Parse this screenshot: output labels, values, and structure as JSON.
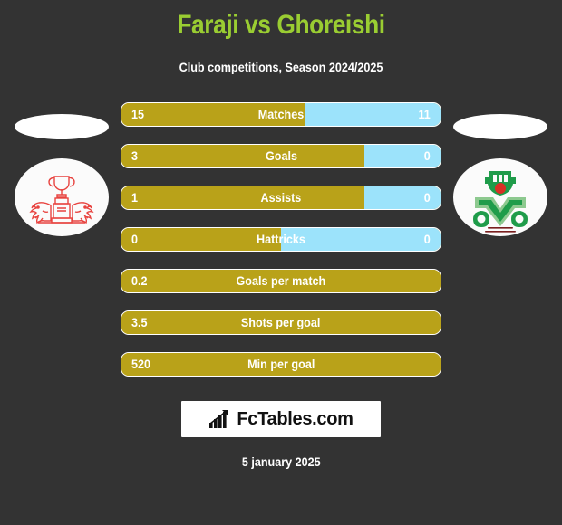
{
  "header": {
    "title": "Faraji vs Ghoreishi",
    "subtitle": "Club competitions, Season 2024/2025",
    "title_color": "#9acd32"
  },
  "colors": {
    "background": "#333333",
    "home_bar": "#b9a219",
    "away_bar": "#9ce3fb",
    "text": "#ffffff",
    "left_crest": "#e8433f",
    "right_crest": "#1f9c4a"
  },
  "players": {
    "home": {
      "name": "Faraji",
      "crest_icon": "trophy-lions-crest-icon",
      "photo_icon": "player-photo-ellipse"
    },
    "away": {
      "name": "Ghoreishi",
      "crest_icon": "green-shield-crest-icon",
      "photo_icon": "player-photo-ellipse"
    }
  },
  "chart_data": {
    "type": "bar",
    "title": "Faraji vs Ghoreishi",
    "subtitle": "Club competitions, Season 2024/2025",
    "orientation": "horizontal-diverging",
    "series": [
      {
        "name": "Faraji",
        "color": "#b9a219"
      },
      {
        "name": "Ghoreishi",
        "color": "#9ce3fb"
      }
    ],
    "categories": [
      "Matches",
      "Goals",
      "Assists",
      "Hattricks",
      "Goals per match",
      "Shots per goal",
      "Min per goal"
    ],
    "rows": [
      {
        "label": "Matches",
        "home": "15",
        "away": "11",
        "home_pct": 57.7,
        "away_shown": true
      },
      {
        "label": "Goals",
        "home": "3",
        "away": "0",
        "home_pct": 76.0,
        "away_shown": true
      },
      {
        "label": "Assists",
        "home": "1",
        "away": "0",
        "home_pct": 76.0,
        "away_shown": true
      },
      {
        "label": "Hattricks",
        "home": "0",
        "away": "0",
        "home_pct": 50.0,
        "away_shown": true
      },
      {
        "label": "Goals per match",
        "home": "0.2",
        "away": "",
        "home_pct": 100.0,
        "away_shown": false
      },
      {
        "label": "Shots per goal",
        "home": "3.5",
        "away": "",
        "home_pct": 100.0,
        "away_shown": false
      },
      {
        "label": "Min per goal",
        "home": "520",
        "away": "",
        "home_pct": 100.0,
        "away_shown": false
      }
    ]
  },
  "footer": {
    "brand_name": "FcTables.com",
    "brand_icon": "bar-chart-arrow-icon",
    "date": "5 january 2025"
  }
}
